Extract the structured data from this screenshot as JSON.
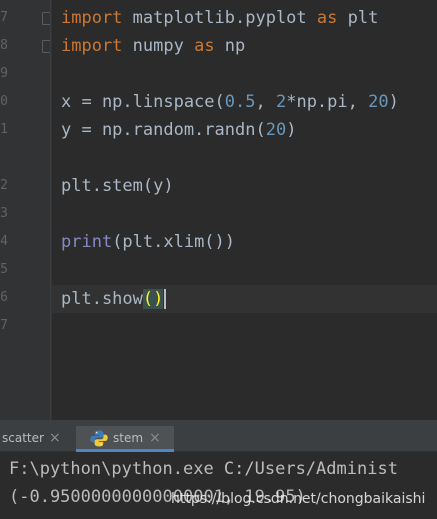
{
  "editor": {
    "gutter_numbers": [
      "7",
      "8",
      "9",
      "0",
      "1",
      "2",
      "3",
      "4",
      "5",
      "6",
      "7"
    ],
    "code": {
      "line1": {
        "kw1": "import",
        "mod": " matplotlib.pyplot ",
        "kw2": "as",
        "alias": " plt"
      },
      "line2": {
        "kw1": "import",
        "mod": " numpy ",
        "kw2": "as",
        "alias": " np"
      },
      "line4": {
        "a": "x = np.linspace(",
        "n1": "0.5",
        "b": ", ",
        "n2": "2",
        "c": "*np.pi, ",
        "n3": "20",
        "d": ")"
      },
      "line5": {
        "a": "y = np.random.randn(",
        "n1": "20",
        "b": ")"
      },
      "line7": {
        "a": "plt.stem(y)"
      },
      "line9": {
        "fn": "print",
        "a": "(plt.xlim())"
      },
      "line11": {
        "a": "plt.show",
        "brackets": "()"
      }
    }
  },
  "run_panel": {
    "tabs": [
      {
        "label": "scatter",
        "close": "×",
        "active": false
      },
      {
        "label": "stem",
        "close": "×",
        "active": true,
        "icon": "python-icon"
      }
    ],
    "console": {
      "line1": "F:\\python\\python.exe C:/Users/Administ",
      "line2": "(-0.95000000000000001, 19.95)"
    }
  },
  "watermark": "https://blog.csdn.net/chongbaikaishi",
  "colors": {
    "background": "#2b2b2b",
    "keyword": "#cc7832",
    "number": "#6897bb",
    "builtin": "#8888c6",
    "text": "#a9b7c6",
    "bracket_match": "#ffef28",
    "active_tab_underline": "#4a88c7"
  }
}
